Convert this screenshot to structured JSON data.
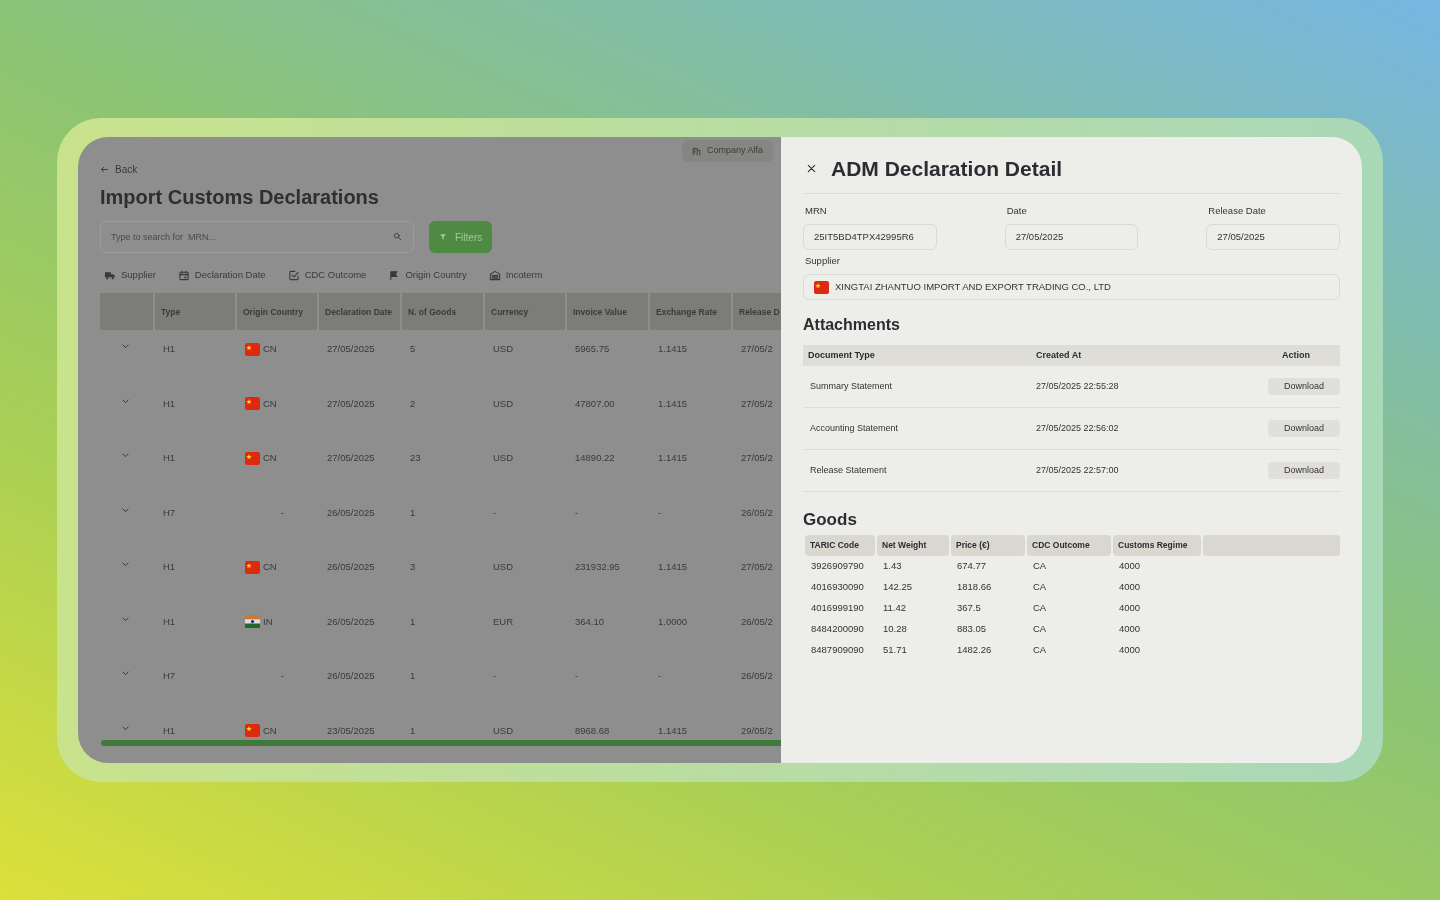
{
  "list_page": {
    "back": "Back",
    "title": "Import Customs Declarations",
    "company": "Company Alfa",
    "search": {
      "placeholder": "Type to search for  MRN..."
    },
    "filters_button": "Filters",
    "filter_chips": [
      {
        "label": "Supplier",
        "kind": "truck"
      },
      {
        "label": "Declaration Date",
        "kind": "calendar"
      },
      {
        "label": "CDC Outcome",
        "kind": "check"
      },
      {
        "label": "Origin Country",
        "kind": "flag"
      },
      {
        "label": "Incoterm",
        "kind": "warehouse"
      }
    ],
    "table": {
      "columns": [
        "Type",
        "Origin Country",
        "Declaration Date",
        "N. of Goods",
        "Currency",
        "Invoice Value",
        "Exchange Rate",
        "Release D"
      ],
      "rows": [
        {
          "type": "H1",
          "kind": "china",
          "origin": "CN",
          "date": "27/05/2025",
          "goods": "5",
          "currency": "USD",
          "invoice": "5965.75",
          "rate": "1.1415",
          "release": "27/05/2"
        },
        {
          "type": "H1",
          "kind": "china",
          "origin": "CN",
          "date": "27/05/2025",
          "goods": "2",
          "currency": "USD",
          "invoice": "47807.00",
          "rate": "1.1415",
          "release": "27/05/2"
        },
        {
          "type": "H1",
          "kind": "china",
          "origin": "CN",
          "date": "27/05/2025",
          "goods": "23",
          "currency": "USD",
          "invoice": "14890.22",
          "rate": "1.1415",
          "release": "27/05/2"
        },
        {
          "type": "H7",
          "kind": "none",
          "origin": "-",
          "date": "26/05/2025",
          "goods": "1",
          "currency": "-",
          "invoice": "-",
          "rate": "-",
          "release": "26/05/2"
        },
        {
          "type": "H1",
          "kind": "china",
          "origin": "CN",
          "date": "26/05/2025",
          "goods": "3",
          "currency": "USD",
          "invoice": "231932.95",
          "rate": "1.1415",
          "release": "27/05/2"
        },
        {
          "type": "H1",
          "kind": "india",
          "origin": "IN",
          "date": "26/05/2025",
          "goods": "1",
          "currency": "EUR",
          "invoice": "364.10",
          "rate": "1.0000",
          "release": "26/05/2"
        },
        {
          "type": "H7",
          "kind": "none",
          "origin": "-",
          "date": "26/05/2025",
          "goods": "1",
          "currency": "-",
          "invoice": "-",
          "rate": "-",
          "release": "26/05/2"
        },
        {
          "type": "H1",
          "kind": "china",
          "origin": "CN",
          "date": "23/05/2025",
          "goods": "1",
          "currency": "USD",
          "invoice": "8968.68",
          "rate": "1.1415",
          "release": "29/05/2"
        }
      ]
    }
  },
  "detail_panel": {
    "title": "ADM Declaration Detail",
    "fields": [
      {
        "label": "MRN",
        "value": "25IT5BD4TPX42995R6"
      },
      {
        "label": "Date",
        "value": "27/05/2025"
      },
      {
        "label": "Release Date",
        "value": "27/05/2025"
      }
    ],
    "supplier": {
      "label": "Supplier",
      "kind": "china",
      "value": "XINGTAI ZHANTUO IMPORT AND EXPORT TRADING CO., LTD"
    },
    "attachments": {
      "heading": "Attachments",
      "columns": [
        "Document Type",
        "Created At",
        "Action"
      ],
      "rows": [
        {
          "document_type": "Summary Statement",
          "created_at": "27/05/2025 22:55:28",
          "action": "Download"
        },
        {
          "document_type": "Accounting Statement",
          "created_at": "27/05/2025 22:56:02",
          "action": "Download"
        },
        {
          "document_type": "Release Statement",
          "created_at": "27/05/2025 22:57:00",
          "action": "Download"
        }
      ]
    },
    "goods": {
      "heading": "Goods",
      "columns": [
        "TARIC Code",
        "Net Weight",
        "Price (€)",
        "CDC Outcome",
        "Customs Regime"
      ],
      "rows": [
        [
          "3926909790",
          "1.43",
          "674.77",
          "CA",
          "4000"
        ],
        [
          "4016930090",
          "142.25",
          "1818.66",
          "CA",
          "4000"
        ],
        [
          "4016999190",
          "11.42",
          "367.5",
          "CA",
          "4000"
        ],
        [
          "8484200090",
          "10.28",
          "883.05",
          "CA",
          "4000"
        ],
        [
          "8487909090",
          "51.71",
          "1482.26",
          "CA",
          "4000"
        ]
      ]
    }
  }
}
